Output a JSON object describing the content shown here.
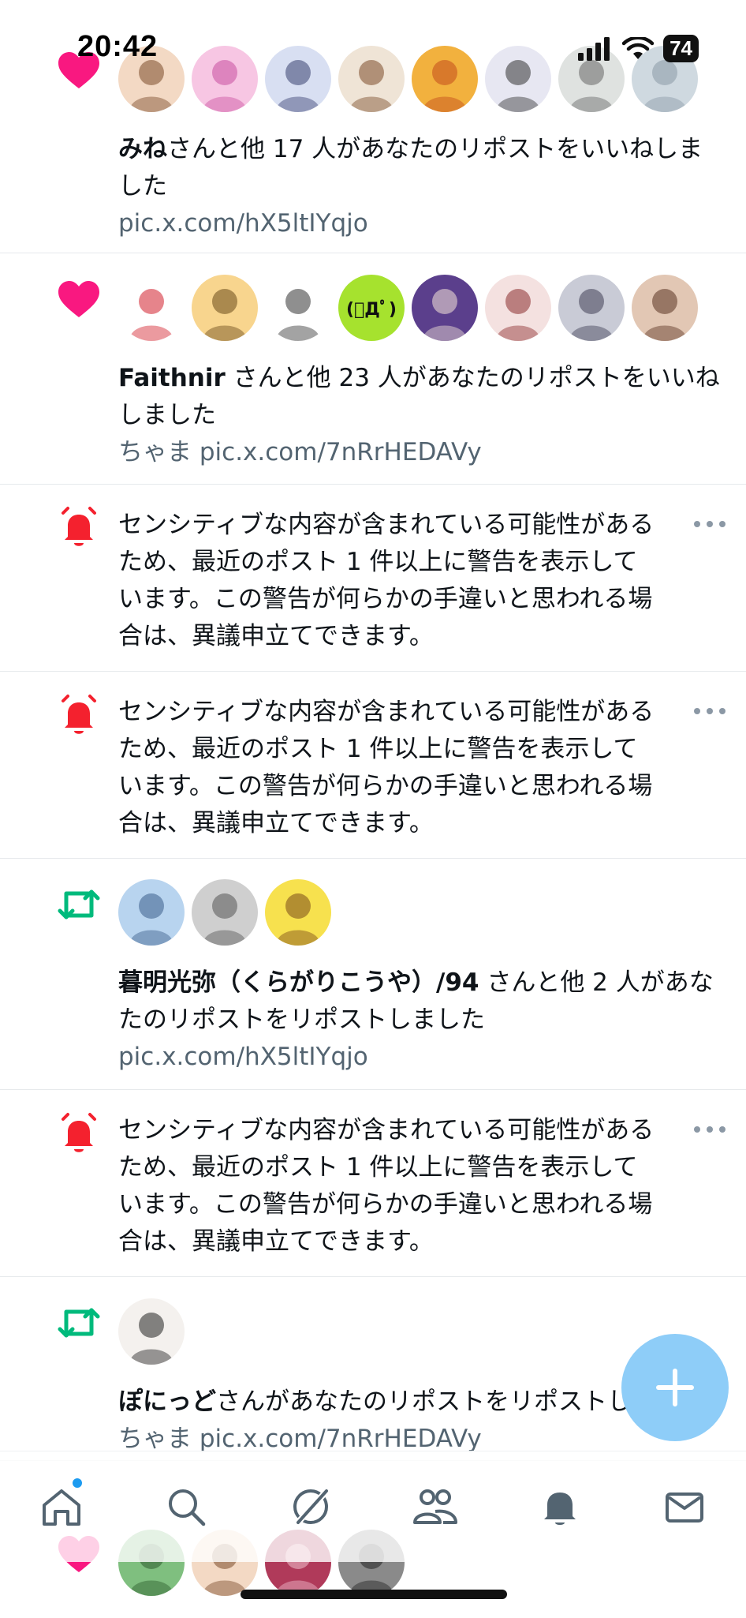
{
  "status": {
    "time": "20:42",
    "battery": "74"
  },
  "feed": [
    {
      "type": "like",
      "avatars": [
        {
          "bg": "#f3d9c4",
          "fg": "#7a4a2a",
          "glyph": ""
        },
        {
          "bg": "#f7c6e3",
          "fg": "#c94fa0",
          "glyph": ""
        },
        {
          "bg": "#d8dff2",
          "fg": "#394070",
          "glyph": ""
        },
        {
          "bg": "#efe4d6",
          "fg": "#7b4b2a",
          "glyph": ""
        },
        {
          "bg": "#f2b13e",
          "fg": "#c24a1b",
          "glyph": ""
        },
        {
          "bg": "#e7e7f2",
          "fg": "#333",
          "glyph": ""
        },
        {
          "bg": "#dfe2e0",
          "fg": "#666",
          "glyph": ""
        },
        {
          "bg": "#cfd9e0",
          "fg": "#8a99a6",
          "glyph": ""
        }
      ],
      "user": "みね",
      "message": "さんと他 17 人があなたのリポストをいいねしました",
      "link": "pic.x.com/hX5ltIYqjo"
    },
    {
      "type": "like",
      "avatars": [
        {
          "bg": "#ffffff",
          "fg": "#d21f2b",
          "glyph": ""
        },
        {
          "bg": "#f8d58e",
          "fg": "#6a4a1a",
          "glyph": ""
        },
        {
          "bg": "#ffffff",
          "fg": "#333",
          "glyph": ""
        },
        {
          "bg": "#a6e22e",
          "fg": "#111",
          "glyph": "(ﾟДﾟ)"
        },
        {
          "bg": "#5b3f8c",
          "fg": "#f5e6d8",
          "glyph": ""
        },
        {
          "bg": "#f4e1e0",
          "fg": "#8b2d2d",
          "glyph": ""
        },
        {
          "bg": "#c9cbd6",
          "fg": "#3f3f55",
          "glyph": ""
        },
        {
          "bg": "#e2c7b4",
          "fg": "#5a3322",
          "glyph": ""
        }
      ],
      "user": "Faithnir",
      "message": " さんと他 23 人があなたのリポストをいいねしました",
      "link": "ちゃま pic.x.com/7nRrHEDAVy"
    },
    {
      "type": "warning",
      "message": "センシティブな内容が含まれている可能性があるため、最近のポスト 1 件以上に警告を表示しています。この警告が何らかの手違いと思われる場合は、異議申立てできます。"
    },
    {
      "type": "warning",
      "message": "センシティブな内容が含まれている可能性があるため、最近のポスト 1 件以上に警告を表示しています。この警告が何らかの手違いと思われる場合は、異議申立てできます。"
    },
    {
      "type": "repost",
      "avatars": [
        {
          "bg": "#b8d4ef",
          "fg": "#3a5d8a",
          "glyph": ""
        },
        {
          "bg": "#cfcfcf",
          "fg": "#555",
          "glyph": ""
        },
        {
          "bg": "#f7e14e",
          "fg": "#7a4a1a",
          "glyph": ""
        }
      ],
      "user": "暮明光弥（くらがりこうや）/94",
      "message": " さんと他 2 人があなたのリポストをリポストしました",
      "link": "pic.x.com/hX5ltIYqjo"
    },
    {
      "type": "warning",
      "message": "センシティブな内容が含まれている可能性があるため、最近のポスト 1 件以上に警告を表示しています。この警告が何らかの手違いと思われる場合は、異議申立てできます。"
    },
    {
      "type": "repost",
      "avatars": [
        {
          "bg": "#f4f1ee",
          "fg": "#222",
          "glyph": ""
        }
      ],
      "user": "ぽにっど",
      "message": "さんがあなたのリポストをリポストしました",
      "link": "ちゃま pic.x.com/7nRrHEDAVy"
    },
    {
      "type": "like",
      "avatars": [
        {
          "bg": "#7fbf7f",
          "fg": "#2d5b2d",
          "glyph": ""
        },
        {
          "bg": "#f3d9c4",
          "fg": "#7a4a2a",
          "glyph": ""
        },
        {
          "bg": "#b03a5a",
          "fg": "#f2c2d0",
          "glyph": ""
        },
        {
          "bg": "#8a8a8a",
          "fg": "#222",
          "glyph": ""
        }
      ],
      "user": "",
      "message": "",
      "link": ""
    }
  ],
  "nav": {
    "items": [
      "home-icon",
      "search-icon",
      "grok-icon",
      "communities-icon",
      "notifications-icon",
      "messages-icon"
    ]
  },
  "colors": {
    "like": "#f91880",
    "repost": "#00ba7c",
    "warning": "#f4212e",
    "accent": "#1d9bf0",
    "fab": "#8ecdf8"
  }
}
